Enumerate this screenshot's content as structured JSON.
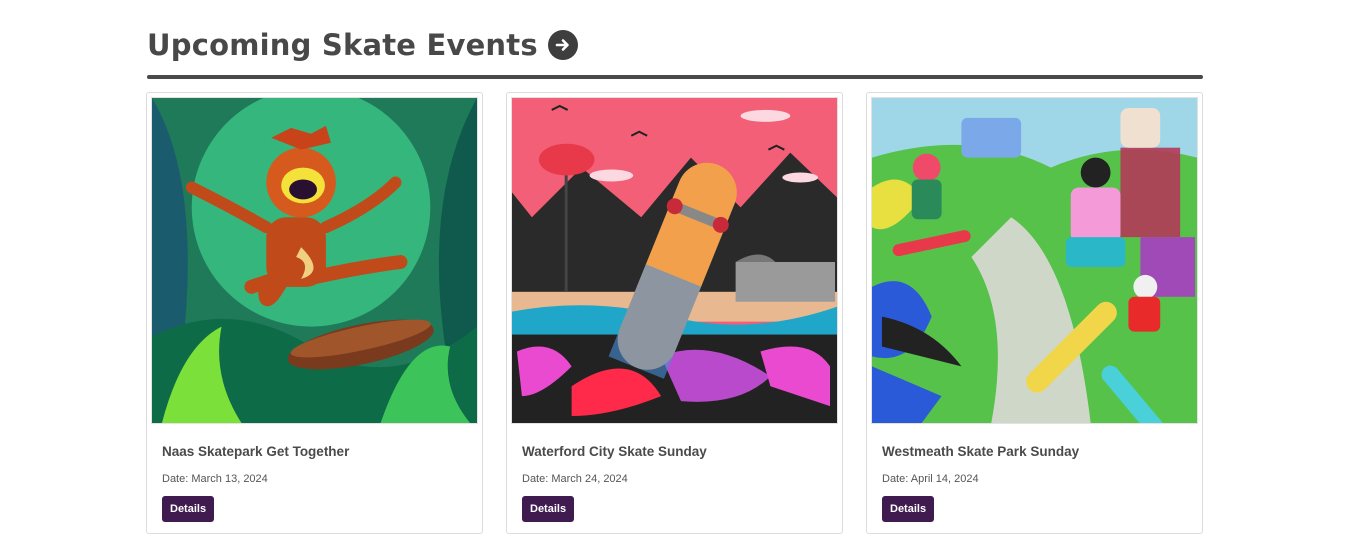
{
  "section": {
    "title": "Upcoming Skate Events"
  },
  "events": [
    {
      "title": "Naas Skatepark Get Together",
      "date": "Date: March 13, 2024",
      "button_label": "Details"
    },
    {
      "title": "Waterford City Skate Sunday",
      "date": "Date: March 24, 2024",
      "button_label": "Details"
    },
    {
      "title": "Westmeath Skate Park Sunday",
      "date": "Date: April 14, 2024",
      "button_label": "Details"
    }
  ],
  "colors": {
    "heading": "#484848",
    "button": "#3f1b50",
    "divider": "#4a4a4a"
  }
}
